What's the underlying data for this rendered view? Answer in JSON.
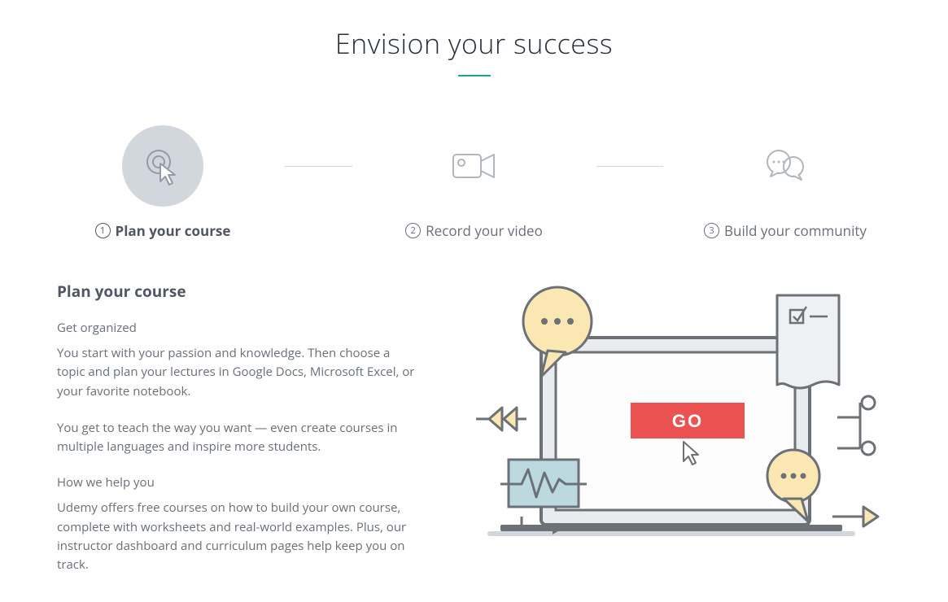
{
  "title": "Envision your success",
  "steps": [
    {
      "num": "1",
      "label": "Plan your course"
    },
    {
      "num": "2",
      "label": "Record your video"
    },
    {
      "num": "3",
      "label": "Build your community"
    }
  ],
  "detail": {
    "heading": "Plan your course",
    "sub1": "Get organized",
    "para1": "You start with your passion and knowledge. Then choose a topic and plan your lectures in Google Docs, Microsoft Excel, or your favorite notebook.",
    "para2": "You get to teach the way you want — even create courses in multiple languages and inspire more students.",
    "sub2": "How we help you",
    "para3": "Udemy offers free courses on how to build your own course, complete with worksheets and real-world examples. Plus, our instructor dashboard and curriculum pages help keep you on track."
  },
  "illustration": {
    "go_label": "GO"
  }
}
